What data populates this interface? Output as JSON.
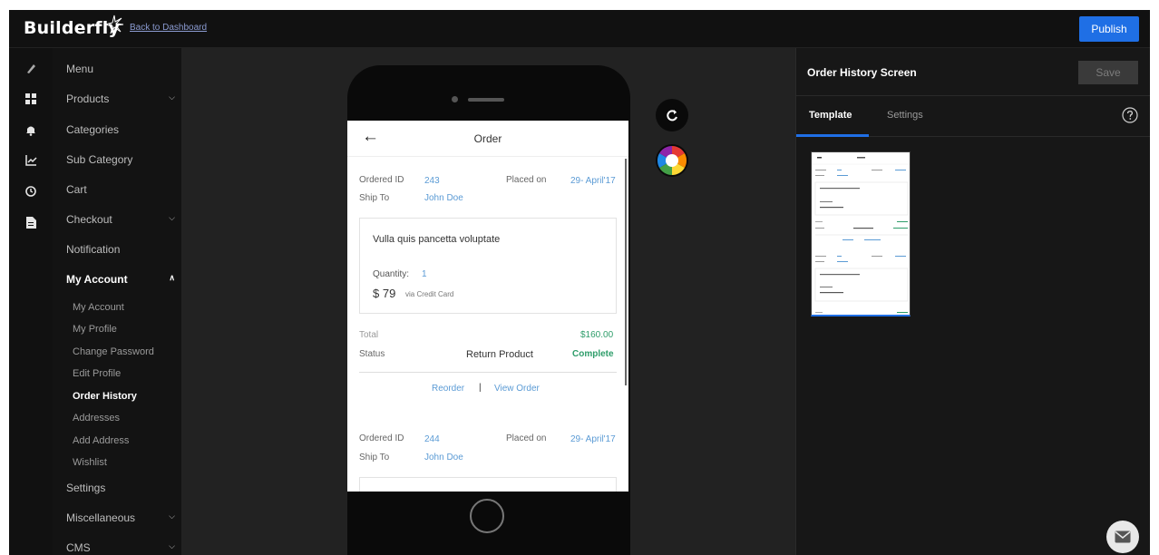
{
  "header": {
    "brand": "Builderfly",
    "back_link": "Back to Dashboard",
    "publish_label": "Publish"
  },
  "rail": {
    "icons": [
      "brush-icon",
      "grid-icon",
      "bell-icon",
      "chart-icon",
      "clock-icon",
      "document-icon"
    ]
  },
  "nav": {
    "items": [
      {
        "label": "Menu"
      },
      {
        "label": "Products"
      },
      {
        "label": "Categories"
      },
      {
        "label": "Sub Category"
      },
      {
        "label": "Cart"
      },
      {
        "label": "Checkout"
      },
      {
        "label": "Notification"
      },
      {
        "label": "My Account"
      },
      {
        "label": "Settings"
      },
      {
        "label": "Miscellaneous"
      },
      {
        "label": "CMS"
      }
    ],
    "sub_items": [
      {
        "label": "My Account"
      },
      {
        "label": "My Profile"
      },
      {
        "label": "Change Password"
      },
      {
        "label": "Edit Profile"
      },
      {
        "label": "Order History"
      },
      {
        "label": "Addresses"
      },
      {
        "label": "Add Address"
      },
      {
        "label": "Wishlist"
      }
    ]
  },
  "phone": {
    "title": "Order",
    "orders": [
      {
        "ordered_id_label": "Ordered ID",
        "ordered_id": "243",
        "placed_on_label": "Placed on",
        "placed_on": "29- April'17",
        "ship_to_label": "Ship To",
        "ship_to": "John Doe",
        "product_name": "Vulla quis pancetta voluptate",
        "quantity_label": "Quantity:",
        "quantity": "1",
        "price": "$ 79",
        "payment": "via Credit Card",
        "total_label": "Total",
        "total": "$160.00",
        "status_label": "Status",
        "return_label": "Return Product",
        "status": "Complete",
        "reorder": "Reorder",
        "separator": "|",
        "view_order": "View Order"
      },
      {
        "ordered_id_label": "Ordered ID",
        "ordered_id": "244",
        "placed_on_label": "Placed on",
        "placed_on": "29- April'17",
        "ship_to_label": "Ship To",
        "ship_to": "John Doe"
      }
    ]
  },
  "tools": {
    "refresh": "refresh-icon",
    "palette": "color-wheel-icon"
  },
  "panel": {
    "title": "Order History Screen",
    "save_label": "Save",
    "tabs": [
      {
        "label": "Template"
      },
      {
        "label": "Settings"
      }
    ]
  },
  "colors": {
    "accent": "#1f6fe5",
    "link": "#5b9bd5",
    "success": "#2e9d6a"
  }
}
